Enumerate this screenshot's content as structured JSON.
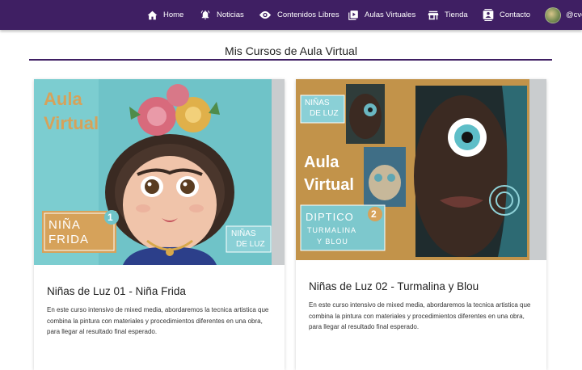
{
  "nav": {
    "items": [
      {
        "label": "Home",
        "icon": "home-icon"
      },
      {
        "label": "Noticias",
        "icon": "bell-icon"
      },
      {
        "label": "Contenidos Libres",
        "icon": "eye-icon"
      },
      {
        "label": "Aulas Virtuales",
        "icon": "video-library-icon"
      },
      {
        "label": "Tienda",
        "icon": "store-icon"
      },
      {
        "label": "Contacto",
        "icon": "contact-icon"
      }
    ],
    "user": "@cve",
    "bg_color": "#3f1f63"
  },
  "page": {
    "title": "Mis Cursos de Aula Virtual"
  },
  "courses": [
    {
      "title": "Niñas de Luz 01 - Niña Frida",
      "description": "En este curso intensivo de mixed media, abordaremos la tecnica artistica que combina la pintura con materiales y procedimientos diferentes en una obra, para llegar al resultado final esperado.",
      "image": {
        "aula": "Aula",
        "virtual": "Virtual",
        "name_line1": "NIÑA",
        "name_line2": "FRIDA",
        "number": "1",
        "brand_line1": "NIÑAS",
        "brand_line2": "DE LUZ"
      }
    },
    {
      "title": "Niñas de Luz 02 - Turmalina y Blou",
      "description": "En este curso intensivo de mixed media, abordaremos la tecnica artistica que combina la pintura con materiales y procedimientos diferentes en una obra, para llegar al resultado final esperado.",
      "image": {
        "aula": "Aula",
        "virtual": "Virtual",
        "brand_line1": "NIÑAS",
        "brand_line2": "DE LUZ",
        "name_line1": "DIPTICO",
        "name_line2": "TURMALINA",
        "name_line3": "Y BLOU",
        "number": "2"
      }
    }
  ]
}
